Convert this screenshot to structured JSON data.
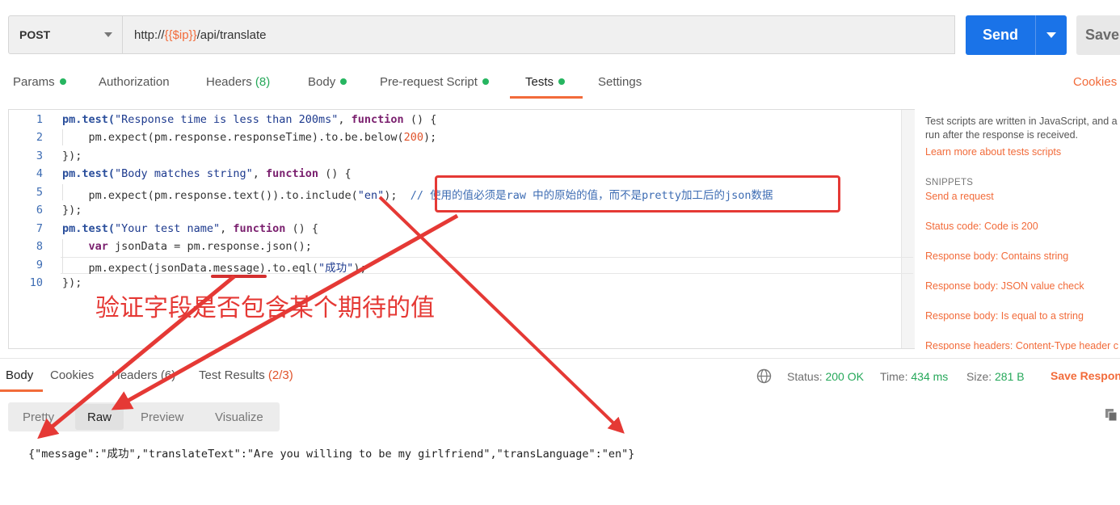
{
  "request": {
    "method": "POST",
    "url_prefix": "http://",
    "url_var": "{{$ip}}",
    "url_suffix": "/api/translate",
    "send_label": "Send",
    "save_label": "Save"
  },
  "tabs": [
    {
      "label": "Params"
    },
    {
      "label": "Authorization"
    },
    {
      "label": "Headers",
      "count": "(8)"
    },
    {
      "label": "Body"
    },
    {
      "label": "Pre-request Script"
    },
    {
      "label": "Tests"
    },
    {
      "label": "Settings"
    }
  ],
  "cookies_link": "Cookies",
  "editor": {
    "line_numbers": [
      "1",
      "2",
      "3",
      "4",
      "5",
      "6",
      "7",
      "8",
      "9",
      "10"
    ],
    "line1": {
      "a": "pm",
      "b": ".test(",
      "c": "\"Response time is less than 200ms\"",
      "d": ", ",
      "e": "function",
      "f": " () {"
    },
    "line2": {
      "a": "    pm.expect(pm.response.responseTime).to.be.below(",
      "b": "200",
      "c": ");"
    },
    "line3": "});",
    "line4": {
      "a": "pm",
      "b": ".test(",
      "c": "\"Body matches string\"",
      "d": ", ",
      "e": "function",
      "f": " () {"
    },
    "line5": {
      "a": "    pm.expect(pm.response.text()).to.include(",
      "b": "\"en\"",
      "c": ");  ",
      "d": "// 使用的值必须是raw 中的原始的值，而不是pretty加工后的json数据"
    },
    "line6": "});",
    "line7": {
      "a": "pm",
      "b": ".test(",
      "c": "\"Your test name\"",
      "d": ", ",
      "e": "function",
      "f": " () {"
    },
    "line8": {
      "a": "    ",
      "b": "var",
      "c": " jsonData = pm.response.json();"
    },
    "line9": {
      "a": "    pm.expect(jsonData.message).to.eql(",
      "b": "\"成功\"",
      "c": ");"
    },
    "line10": "});"
  },
  "side_panel": {
    "description_1": "Test scripts are written in JavaScript, and a",
    "description_2": "run after the response is received.",
    "learn_more": "Learn more about tests scripts",
    "snippets_title": "SNIPPETS",
    "snippets": [
      "Send a request",
      "Status code: Code is 200",
      "Response body: Contains string",
      "Response body: JSON value check",
      "Response body: Is equal to a string",
      "Response headers: Content-Type header c"
    ]
  },
  "response": {
    "tabs": {
      "body": "Body",
      "cookies": "Cookies",
      "headers": "Headers (6)",
      "test_results": "Test Results",
      "test_results_count": "(2/3)"
    },
    "status_label": "Status:",
    "status_value": "200 OK",
    "time_label": "Time:",
    "time_value": "434 ms",
    "size_label": "Size:",
    "size_value": "281 B",
    "save_response": "Save Respon",
    "views": [
      "Pretty",
      "Raw",
      "Preview",
      "Visualize"
    ],
    "raw_body": "{\"message\":\"成功\",\"translateText\":\"Are you willing to be my girlfriend\",\"transLanguage\":\"en\"}"
  },
  "annotation": {
    "text": "验证字段是否包含某个期待的值"
  },
  "colors": {
    "accent": "#f26b3a",
    "send_blue": "#1a73e8",
    "ok_green": "#26a85a",
    "annotation_red": "#e53935"
  }
}
